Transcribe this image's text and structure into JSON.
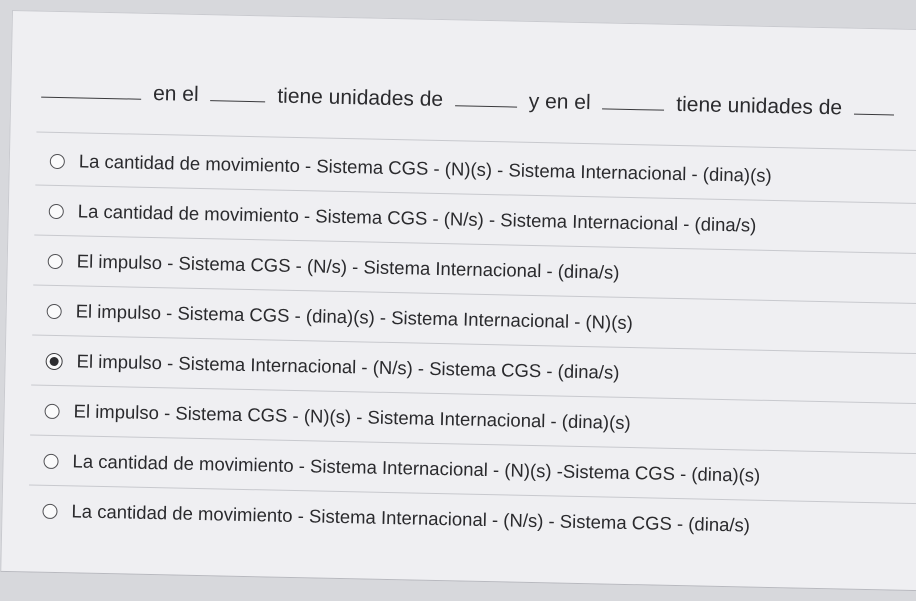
{
  "question": {
    "parts": [
      "en el",
      "tiene unidades de",
      "y en el",
      "tiene unidades de"
    ]
  },
  "options": [
    {
      "label": "La cantidad de movimiento - Sistema CGS - (N)(s)  - Sistema Internacional - (dina)(s)",
      "selected": false
    },
    {
      "label": "La cantidad de movimiento - Sistema CGS - (N/s)  - Sistema Internacional - (dina/s)",
      "selected": false
    },
    {
      "label": "El impulso - Sistema CGS - (N/s)  - Sistema Internacional - (dina/s)",
      "selected": false
    },
    {
      "label": "El impulso - Sistema CGS - (dina)(s) - Sistema Internacional - (N)(s)",
      "selected": false
    },
    {
      "label": "El impulso - Sistema Internacional - (N/s)  - Sistema CGS - (dina/s)",
      "selected": true
    },
    {
      "label": "El impulso - Sistema CGS - (N)(s)  - Sistema Internacional - (dina)(s)",
      "selected": false
    },
    {
      "label": "La cantidad de movimiento - Sistema Internacional - (N)(s)  -Sistema CGS - (dina)(s)",
      "selected": false
    },
    {
      "label": "La cantidad de movimiento - Sistema Internacional - (N/s)  - Sistema CGS - (dina/s)",
      "selected": false
    }
  ]
}
